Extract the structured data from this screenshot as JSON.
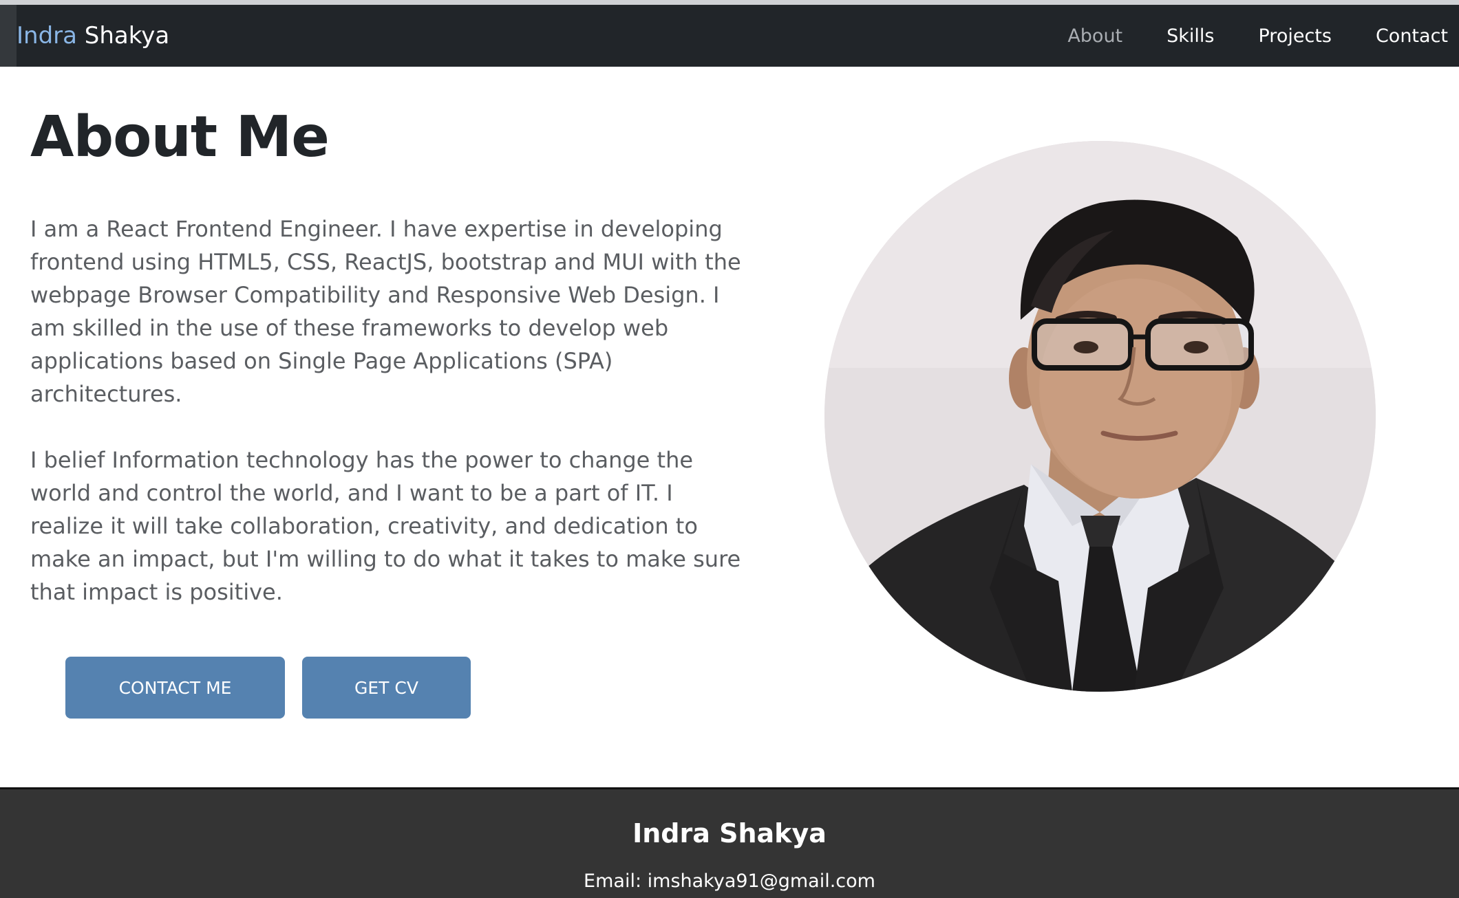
{
  "nav": {
    "brand_first": "Indra",
    "brand_last": "Shakya",
    "links": [
      {
        "label": "About",
        "active": true
      },
      {
        "label": "Skills",
        "active": false
      },
      {
        "label": "Projects",
        "active": false
      },
      {
        "label": "Contact",
        "active": false
      }
    ]
  },
  "about": {
    "title": "About Me",
    "paragraphs": [
      "I am a React Frontend Engineer. I have expertise in developing frontend using HTML5, CSS, ReactJS, bootstrap and MUI with the webpage Browser Compatibility and Responsive Web Design. I am skilled in the use of these frameworks to develop web applications based on Single Page Applications (SPA) architectures.",
      "I belief Information technology has the power to change the world and control the world, and I want to be a part of IT. I realize it will take collaboration, creativity, and dedication to make an impact, but I'm willing to do what it takes to make sure that impact is positive."
    ],
    "buttons": {
      "contact": "CONTACT ME",
      "cv": "GET CV"
    }
  },
  "footer": {
    "name": "Indra Shakya",
    "email": "Email: imshakya91@gmail.com"
  },
  "colors": {
    "navbar": "#212529",
    "brand_accent": "#8ab6e6",
    "button": "#5582b0",
    "footer": "#343434"
  }
}
